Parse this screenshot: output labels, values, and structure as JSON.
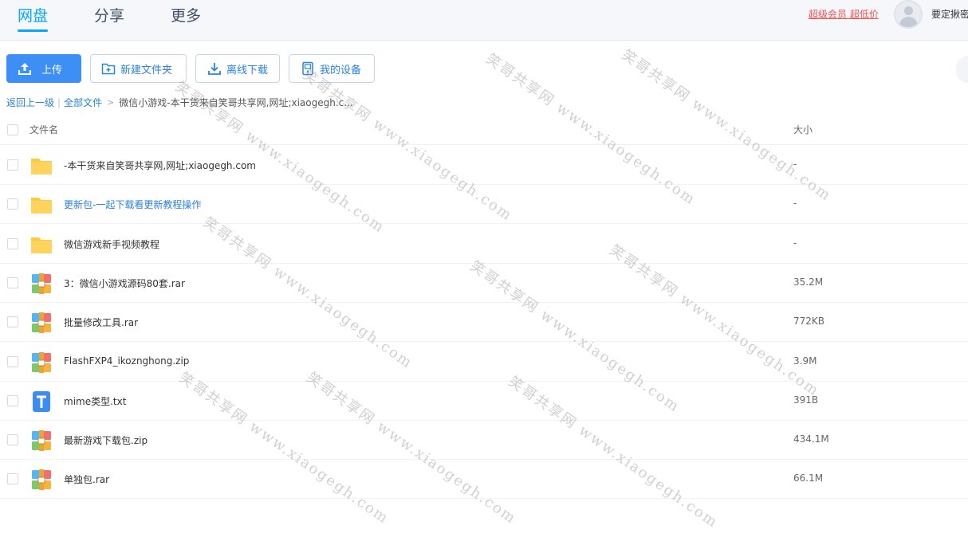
{
  "nav": {
    "tabs": [
      {
        "label": "网盘",
        "active": true
      },
      {
        "label": "分享",
        "active": false
      },
      {
        "label": "更多",
        "active": false
      }
    ],
    "vip_label": "超级会员 超低价",
    "username": "要定揪密"
  },
  "toolbar": {
    "upload": "上传",
    "new_folder": "新建文件夹",
    "offline_download": "离线下载",
    "my_devices": "我的设备"
  },
  "breadcrumb": {
    "back": "返回上一级",
    "separator": "|",
    "all_files": "全部文件",
    "arrow": ">",
    "current": "微信小游戏-本干货来自笑哥共享网,网址;xiaogegh.c..."
  },
  "list": {
    "header_name": "文件名",
    "header_size": "大小",
    "rows": [
      {
        "name": "-本干货来自笑哥共享网,网址;xiaogegh.com",
        "size": "-",
        "type": "folder"
      },
      {
        "name": "更新包-一起下载看更新教程操作",
        "size": "-",
        "type": "folder",
        "link": true
      },
      {
        "name": "微信游戏新手视频教程",
        "size": "-",
        "type": "folder"
      },
      {
        "name": "3：微信小游戏源码80套.rar",
        "size": "35.2M",
        "type": "archive"
      },
      {
        "name": "批量修改工具.rar",
        "size": "772KB",
        "type": "archive"
      },
      {
        "name": "FlashFXP4_ikoznghong.zip",
        "size": "3.9M",
        "type": "archive"
      },
      {
        "name": "mime类型.txt",
        "size": "391B",
        "type": "text"
      },
      {
        "name": "最新游戏下载包.zip",
        "size": "434.1M",
        "type": "archive"
      },
      {
        "name": "单独包.rar",
        "size": "66.1M",
        "type": "archive"
      }
    ]
  },
  "watermark": "笑哥共享网 www.xiaogegh.com",
  "colors": {
    "accent": "#06a7ff",
    "primary_button": "#3d8ff6",
    "link": "#2a82e4",
    "vip": "#f25151",
    "folder": "#ffc940"
  },
  "icons": {
    "upload": "upload-icon",
    "new_folder": "folder-plus-icon",
    "offline_download": "download-icon",
    "my_devices": "device-icon",
    "folder": "folder-icon",
    "archive": "archive-icon",
    "text": "text-file-icon"
  }
}
